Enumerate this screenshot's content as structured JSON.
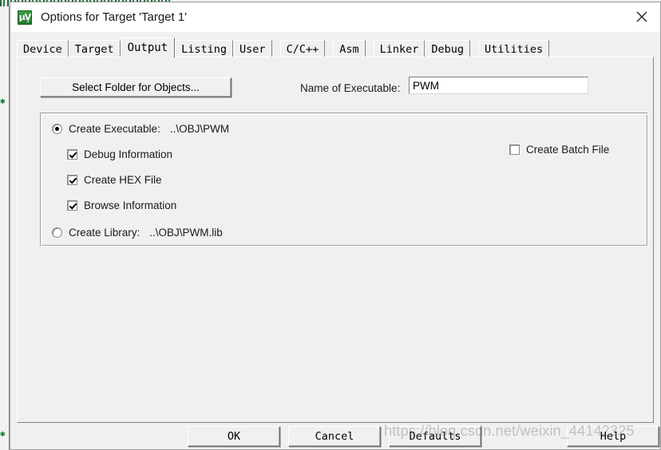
{
  "window": {
    "title": "Options for Target 'Target 1'",
    "icon": "keil-uvision5-icon",
    "icon_glyph": "μV",
    "icon_sub": "5",
    "close_label": "✕"
  },
  "tabs": [
    {
      "label": "Device",
      "active": false
    },
    {
      "label": "Target",
      "active": false
    },
    {
      "label": "Output",
      "active": true
    },
    {
      "label": "Listing",
      "active": false
    },
    {
      "label": "User",
      "active": false
    },
    {
      "label": "C/C++",
      "active": false
    },
    {
      "label": "Asm",
      "active": false
    },
    {
      "label": "Linker",
      "active": false
    },
    {
      "label": "Debug",
      "active": false
    },
    {
      "label": "Utilities",
      "active": false
    }
  ],
  "output_page": {
    "select_folder_button": "Select Folder for Objects...",
    "executable_name_label": "Name of Executable:",
    "executable_name_value": "PWM",
    "executable_name_placeholder": "",
    "create_executable": {
      "label": "Create Executable:",
      "path": "..\\OBJ\\PWM",
      "selected": true
    },
    "debug_information": {
      "label": "Debug Information",
      "checked": true
    },
    "create_hex_file": {
      "label": "Create HEX File",
      "checked": true
    },
    "browse_information": {
      "label": "Browse Information",
      "checked": true
    },
    "create_batch_file": {
      "label": "Create Batch File",
      "checked": false
    },
    "create_library": {
      "label": "Create Library:",
      "path": "..\\OBJ\\PWM.lib",
      "selected": false
    }
  },
  "footer": {
    "ok": "OK",
    "cancel": "Cancel",
    "defaults": "Defaults",
    "help": "Help"
  },
  "watermark": "https://blog.csdn.net/weixin_44142325",
  "colors": {
    "dialog_face": "#f0f0f0",
    "titlebar": "#ffffff",
    "field_bg": "#ffffff",
    "border": "#a0a0a0",
    "text": "#1a1a1a",
    "icon_green": "#2f7d3a"
  }
}
